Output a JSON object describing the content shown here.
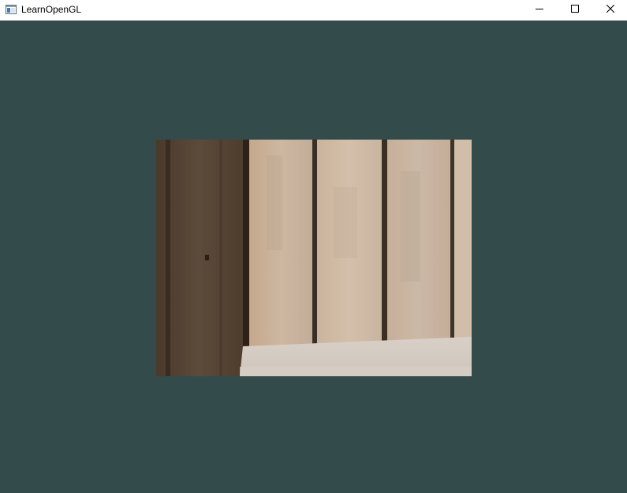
{
  "window": {
    "title": "LearnOpenGL",
    "app_icon": "window-app-icon",
    "controls": {
      "minimize_icon": "minimize-icon",
      "maximize_icon": "maximize-icon",
      "close_icon": "close-icon"
    }
  },
  "client": {
    "clear_color": "#344b4b",
    "texture": "wood-planks-texture"
  }
}
